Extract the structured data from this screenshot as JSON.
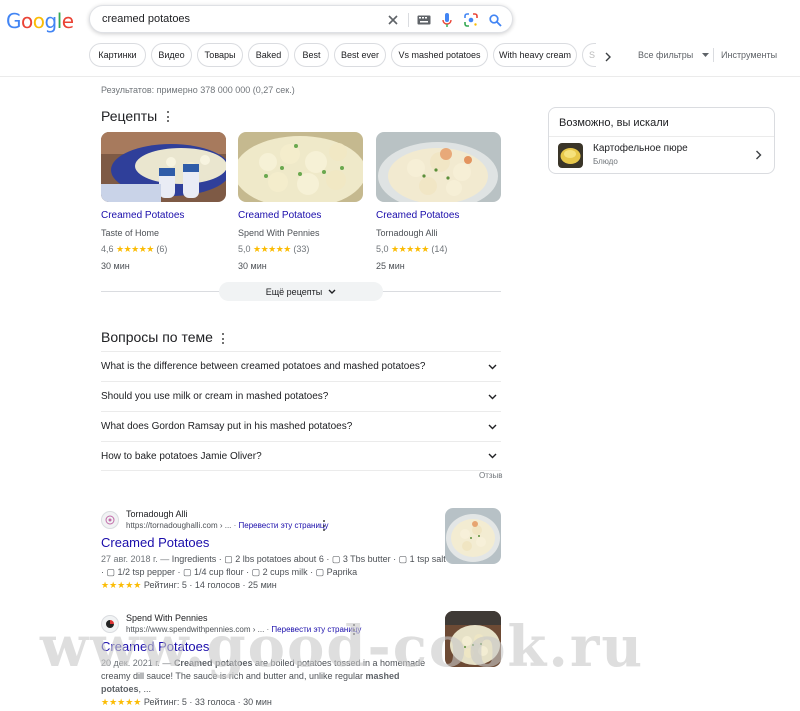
{
  "logo": {
    "text": "Google"
  },
  "search": {
    "query": "creamed potatoes"
  },
  "chips": [
    "Картинки",
    "Видео",
    "Товары",
    "Baked",
    "Best",
    "Best ever",
    "Vs mashed potatoes",
    "With heavy cream",
    "S"
  ],
  "tools": {
    "all_filters": "Все фильтры",
    "tools": "Инструменты"
  },
  "stats": "Результатов: примерно 378 000 000 (0,27 сек.)",
  "recipes": {
    "heading": "Рецепты",
    "cards": [
      {
        "title": "Creamed Potatoes",
        "source": "Taste of Home",
        "rating": "4,6",
        "stars": "★★★★★",
        "count": "(6)",
        "time": "30 мин"
      },
      {
        "title": "Creamed Potatoes",
        "source": "Spend With Pennies",
        "rating": "5,0",
        "stars": "★★★★★",
        "count": "(33)",
        "time": "30 мин"
      },
      {
        "title": "Creamed Potatoes",
        "source": "Tornadough Alli",
        "rating": "5,0",
        "stars": "★★★★★",
        "count": "(14)",
        "time": "25 мин"
      }
    ],
    "more": "Ещё рецепты"
  },
  "questions": {
    "heading": "Вопросы по теме",
    "items": [
      "What is the difference between creamed potatoes and mashed potatoes?",
      "Should you use milk or cream in mashed potatoes?",
      "What does Gordon Ramsay put in his mashed potatoes?",
      "How to bake potatoes Jamie Oliver?"
    ],
    "feedback": "Отзыв"
  },
  "results": [
    {
      "site": "Tornadough Alli",
      "url": "https://tornadoughalli.com › ...",
      "translate": "Перевести эту страницу",
      "title": "Creamed Potatoes",
      "date": "27 авг. 2018 г. —",
      "snippet_l1": "Ingredients · ▢ 2 lbs potatoes about 6 · ▢ 3 Tbs butter · ▢ 1 tsp salt",
      "snippet_l2": "· ▢ 1/2 tsp pepper · ▢ 1/4 cup flour · ▢ 2 cups milk · ▢ Paprika",
      "rating_stars": "★★★★★",
      "rating_text": "Рейтинг: 5 · 14 голосов · 25 мин"
    },
    {
      "site": "Spend With Pennies",
      "url": "https://www.spendwithpennies.com › ...",
      "translate": "Перевести эту страницу",
      "title": "Creamed Potatoes",
      "date": "20 дек. 2021 г. —",
      "snippet_l1a": "Creamed potatoes",
      "snippet_l1b": " are boiled potatoes tossed in a homemade",
      "snippet_l2": "creamy dill sauce! The sauce is rich and butter and, unlike regular ",
      "snippet_l2b": "mashed",
      "snippet_l3": "potatoes",
      "snippet_l3b": ", ...",
      "rating_stars": "★★★★★",
      "rating_text": "Рейтинг: 5 · 33 голоса · 30 мин"
    }
  ],
  "knowledge_panel": {
    "heading": "Возможно, вы искали",
    "item_title": "Картофельное пюре",
    "item_subtitle": "Блюдо"
  },
  "watermark": "www.good-cook.ru",
  "colors": {
    "link": "#1a0dab",
    "star": "#fbbc04",
    "text": "#202124"
  }
}
